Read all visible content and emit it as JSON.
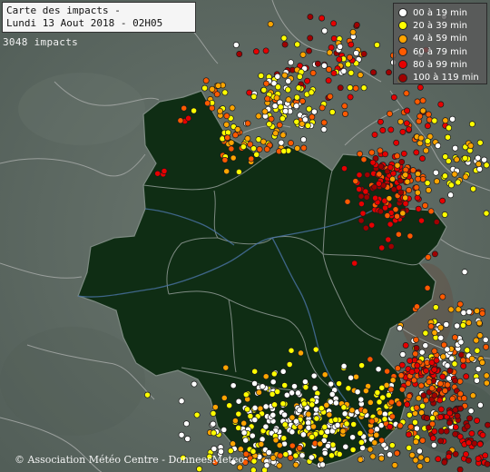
{
  "header": {
    "title_line1": "Carte des impacts -",
    "title_line2": "Lundi 13 Aout 2018 - 02H05"
  },
  "impact_count": "3048 impacts",
  "legend": {
    "items": [
      {
        "label": "00 à 19 min",
        "color": "#ffffff"
      },
      {
        "label": "20 à 39 min",
        "color": "#ffff00"
      },
      {
        "label": "40 à 59 min",
        "color": "#ffa500"
      },
      {
        "label": "60 à 79 min",
        "color": "#ff5a00"
      },
      {
        "label": "80 à 99 min",
        "color": "#e60000"
      },
      {
        "label": "100 à 119 min",
        "color": "#a00000"
      }
    ]
  },
  "credit": "© Association Météo Centre - DonneesMeteo",
  "colors": {
    "region_fill": "#0f2d14",
    "background": "#5c6a63",
    "border_line": "#9a9f9c",
    "river": "#4a73a5"
  }
}
